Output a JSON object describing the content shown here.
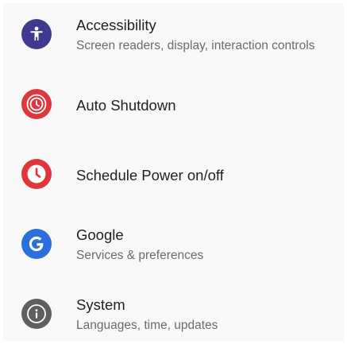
{
  "settings": {
    "items": [
      {
        "title": "Accessibility",
        "subtitle": "Screen readers, display, interaction controls",
        "icon": "accessibility-icon",
        "color": "#3f3a8f"
      },
      {
        "title": "Auto Shutdown",
        "icon": "auto-shutdown-clock-icon",
        "color": "#e0353b"
      },
      {
        "title": "Schedule Power on/off",
        "icon": "schedule-clock-icon",
        "color": "#e0353b"
      },
      {
        "title": "Google",
        "subtitle": "Services & preferences",
        "icon": "google-icon",
        "color": "#2a6fdb"
      },
      {
        "title": "System",
        "subtitle": "Languages, time, updates",
        "icon": "info-icon",
        "color": "#5f5f5f"
      }
    ]
  }
}
